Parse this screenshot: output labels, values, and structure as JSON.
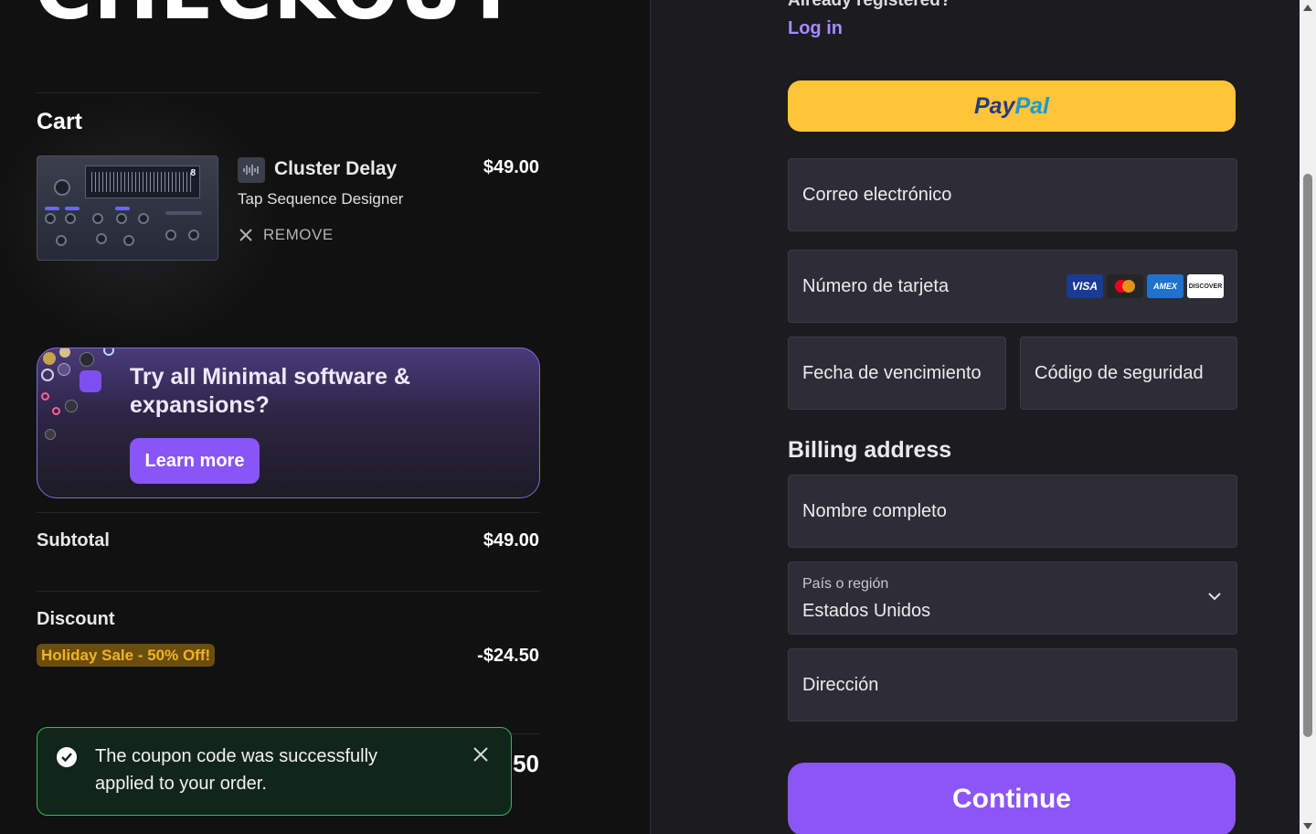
{
  "page": {
    "title": "CHECKOUT"
  },
  "cart": {
    "heading": "Cart",
    "item": {
      "name": "Cluster Delay",
      "subtitle": "Tap Sequence Designer",
      "price": "$49.00",
      "remove_label": "REMOVE",
      "plugin_screen_number": "8"
    }
  },
  "promo": {
    "text": "Try all Minimal software & expansions?",
    "button_label": "Learn more"
  },
  "summary": {
    "subtotal_label": "Subtotal",
    "subtotal_value": "$49.00",
    "discount_label": "Discount",
    "discount_badge": "Holiday Sale - 50% Off!",
    "discount_value": "-$24.50",
    "total_partial": "50"
  },
  "toast": {
    "message": "The coupon code was successfully applied to your order.",
    "status_color": "#2cbf52"
  },
  "account": {
    "already_text": "Already registered?",
    "login_label": "Log in"
  },
  "payment": {
    "paypal_pay": "Pay",
    "paypal_pal": "Pal",
    "email_placeholder": "Correo electrónico",
    "card_number_placeholder": "Número de tarjeta",
    "expiry_placeholder": "Fecha de vencimiento",
    "cvc_placeholder": "Código de seguridad",
    "card_brands": [
      "VISA",
      "mastercard",
      "AMEX",
      "DISCOVER"
    ]
  },
  "billing": {
    "heading": "Billing address",
    "name_placeholder": "Nombre completo",
    "country_label": "País o región",
    "country_value": "Estados Unidos",
    "address_placeholder": "Dirección"
  },
  "actions": {
    "continue_label": "Continue"
  },
  "colors": {
    "accent": "#8b55f7",
    "paypal_yellow": "#ffc439",
    "badge_text": "#f2b323",
    "link": "#a58bff"
  }
}
